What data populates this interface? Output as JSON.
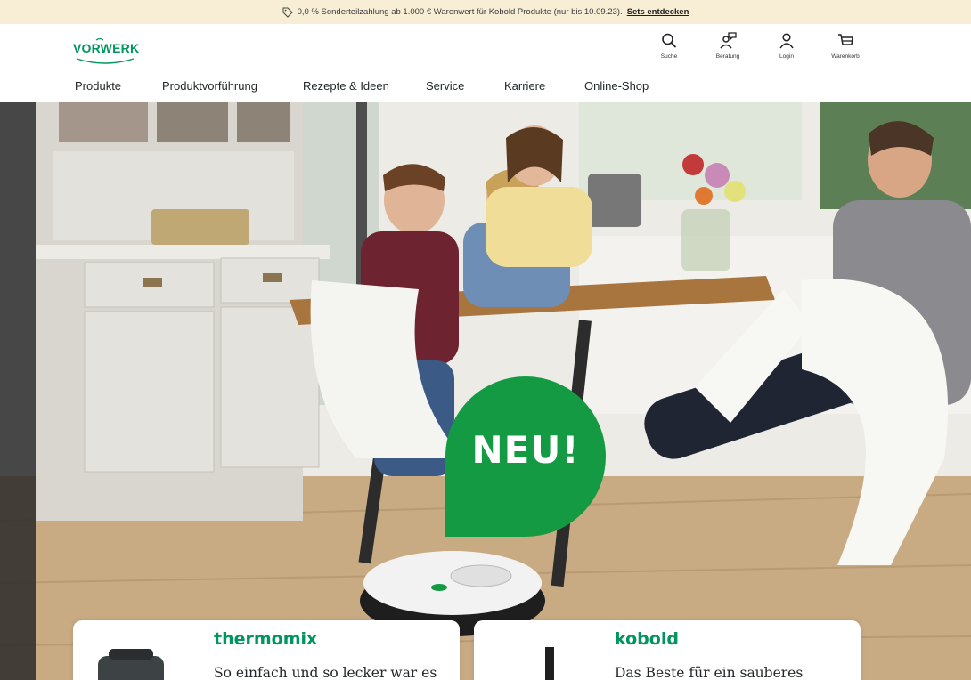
{
  "promo": {
    "text": "0,0 % Sonderteilzahlung ab 1.000 € Warenwert für Kobold Produkte (nur bis 10.09.23).",
    "link_label": "Sets entdecken"
  },
  "header": {
    "logo_text": "VORWERK",
    "icons": [
      {
        "name": "search",
        "label": "Suche"
      },
      {
        "name": "advice",
        "label": "Beratung"
      },
      {
        "name": "login",
        "label": "Login"
      },
      {
        "name": "cart",
        "label": "Warenkorb"
      }
    ]
  },
  "nav": {
    "items": [
      "Produkte",
      "Produktvorführung",
      "Rezepte & Ideen",
      "Service",
      "Karriere",
      "Online-Shop"
    ]
  },
  "hero": {
    "badge": "NEU!"
  },
  "cards": [
    {
      "brand": "thermomix",
      "teaser": "So einfach und so lecker war es"
    },
    {
      "brand": "kobold",
      "teaser": "Das Beste für ein sauberes"
    }
  ],
  "colors": {
    "brand_green": "#00965e",
    "badge_green": "#139a43",
    "promo_bg": "#f7eed5"
  }
}
